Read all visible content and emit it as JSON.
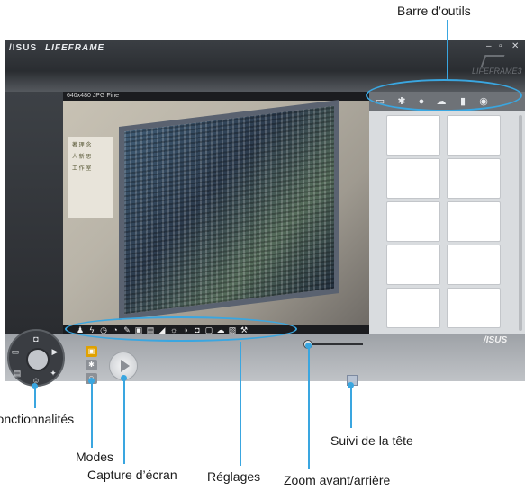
{
  "annotations": {
    "toolbar": "Barre d’outils",
    "features": "Fonctionnalités",
    "modes": "Modes",
    "capture": "Capture d’écran",
    "settings": "Réglages",
    "zoom": "Zoom avant/arrière",
    "head_tracking": "Suivi de la tête"
  },
  "app": {
    "brand": "/ISUS",
    "name": "LIFEFRAME",
    "logo_right": "LIFEFRAME3",
    "asus_bottom": "/ISUS",
    "window_controls": [
      "–",
      "▫",
      "✕"
    ]
  },
  "camera": {
    "status": "640x480 JPG Fine",
    "sign_lines": [
      "著 理 念",
      "人 新 思",
      "工 作 室"
    ]
  },
  "toolbar_icons": [
    "folder-icon",
    "gear-icon",
    "head-icon",
    "cloud-icon",
    "microphone-icon",
    "eye-icon"
  ],
  "settings_icons": [
    "people-icon",
    "flash-icon",
    "timer-icon",
    "effects-icon",
    "pencil-icon",
    "frame-icon",
    "frame2-icon",
    "contrast-icon",
    "brightness-icon",
    "half-circle-icon",
    "color-icon",
    "filter-icon",
    "cloud-icon",
    "picture-icon",
    "wrench-icon"
  ],
  "colors": {
    "callout": "#3aa6e0",
    "titlebar": "#2a2d31",
    "accent_mode": "#e0a100"
  }
}
